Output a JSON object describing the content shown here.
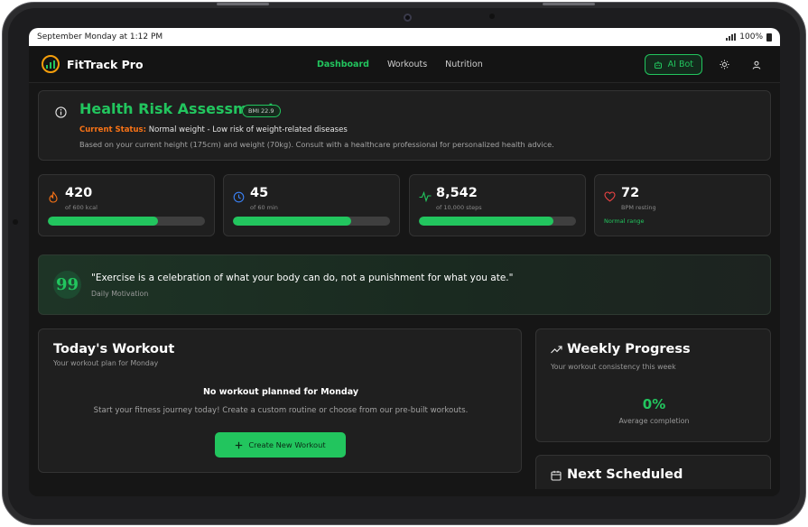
{
  "status_bar": {
    "datetime": "September Monday at 1:12 PM",
    "battery": "100%"
  },
  "nav": {
    "brand": "FitTrack Pro",
    "links": [
      "Dashboard",
      "Workouts",
      "Nutrition"
    ],
    "active_link": "Dashboard",
    "ai_button": "AI Bot"
  },
  "health": {
    "title": "Health Risk Assessment",
    "bmi_badge": "BMI 22.9",
    "status_label": "Current Status:",
    "status_value": "Normal weight - Low risk of weight-related diseases",
    "description": "Based on your current height (175cm) and weight (70kg). Consult with a healthcare professional for personalized health advice."
  },
  "stats": [
    {
      "icon": "flame-icon",
      "value": "420",
      "sub": "of 600 kcal",
      "progress": 0.7,
      "color": "#f97316"
    },
    {
      "icon": "clock-icon",
      "value": "45",
      "sub": "of 60 min",
      "progress": 0.75,
      "color": "#3b82f6"
    },
    {
      "icon": "activity-icon",
      "value": "8,542",
      "sub": "of 10,000 steps",
      "progress": 0.854,
      "color": "#22c55e"
    },
    {
      "icon": "heart-icon",
      "value": "72",
      "sub": "BPM resting",
      "range": "Normal range",
      "color": "#ef4444"
    }
  ],
  "quote": {
    "text": "\"Exercise is a celebration of what your body can do, not a punishment for what you ate.\"",
    "sub": "Daily Motivation"
  },
  "workout": {
    "title": "Today's Workout",
    "subtitle": "Your workout plan for Monday",
    "empty_title": "No workout planned for Monday",
    "empty_desc": "Start your fitness journey today! Create a custom routine or choose from our pre-built workouts.",
    "button": "Create New Workout"
  },
  "weekly": {
    "title": "Weekly Progress",
    "subtitle": "Your workout consistency this week",
    "value": "0%",
    "value_label": "Average completion"
  },
  "next": {
    "title": "Next Scheduled"
  },
  "colors": {
    "accent": "#22c55e",
    "warning": "#f97316",
    "background": "#161616",
    "card": "#1f1f1f"
  }
}
